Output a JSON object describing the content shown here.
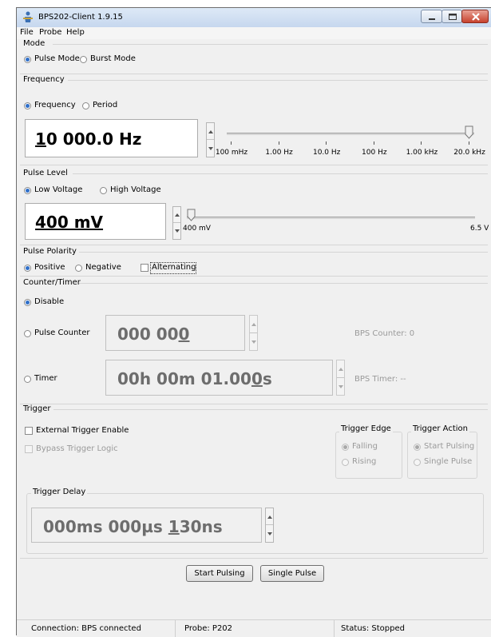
{
  "window": {
    "title": "BPS202-Client 1.9.15",
    "icons": {
      "app": "app-person-icon",
      "min": "minimize-icon",
      "max": "maximize-icon",
      "close": "close-icon"
    }
  },
  "menu": [
    "File",
    "Probe",
    "Help"
  ],
  "mode": {
    "label": "Mode",
    "options": [
      {
        "label": "Pulse Mode",
        "checked": true
      },
      {
        "label": "Burst Mode",
        "checked": false
      }
    ]
  },
  "frequency": {
    "label": "Frequency",
    "options": [
      {
        "label": "Frequency",
        "checked": true
      },
      {
        "label": "Period",
        "checked": false
      }
    ],
    "value_prefix": "1",
    "value_rest": "0 000.0 Hz",
    "slider_ticks": [
      "100 mHz",
      "1.00 Hz",
      "10.0 Hz",
      "100 Hz",
      "1.00 kHz",
      "20.0 kHz"
    ],
    "slider_position": 1.0
  },
  "pulse_level": {
    "label": "Pulse Level",
    "options": [
      {
        "label": "Low Voltage",
        "checked": true
      },
      {
        "label": "High Voltage",
        "checked": false
      }
    ],
    "value": "400 mV",
    "slider_min": "400 mV",
    "slider_max": "6.5 V",
    "slider_position": 0.0
  },
  "pulse_polarity": {
    "label": "Pulse Polarity",
    "options": [
      {
        "label": "Positive",
        "checked": true
      },
      {
        "label": "Negative",
        "checked": false
      }
    ],
    "alternating_label": "Alternating",
    "alternating_checked": false
  },
  "counter_timer": {
    "label": "Counter/Timer",
    "disable_label": "Disable",
    "pulse_counter_label": "Pulse Counter",
    "pulse_counter_value_main": "000 00",
    "pulse_counter_value_last": "0",
    "bps_counter": "BPS Counter: 0",
    "timer_label": "Timer",
    "timer_value_main": "00h 00m 01.00",
    "timer_value_last": "0",
    "timer_value_suffix": "s",
    "bps_timer": "BPS Timer: --"
  },
  "trigger": {
    "label": "Trigger",
    "external_label": "External Trigger Enable",
    "bypass_label": "Bypass Trigger Logic",
    "edge_label": "Trigger Edge",
    "edge_options": [
      {
        "label": "Falling",
        "checked": true
      },
      {
        "label": "Rising",
        "checked": false
      }
    ],
    "action_label": "Trigger Action",
    "action_options": [
      {
        "label": "Start Pulsing",
        "checked": true
      },
      {
        "label": "Single Pulse",
        "checked": false
      }
    ],
    "delay_label": "Trigger Delay",
    "delay_value_main": "000ms 000µs ",
    "delay_value_underlined": "1",
    "delay_value_rest": "30ns"
  },
  "buttons": {
    "start_pulsing": "Start Pulsing",
    "single_pulse": "Single Pulse"
  },
  "status": {
    "connection": "Connection: BPS connected",
    "probe": "Probe: P202",
    "state": "Status: Stopped"
  }
}
